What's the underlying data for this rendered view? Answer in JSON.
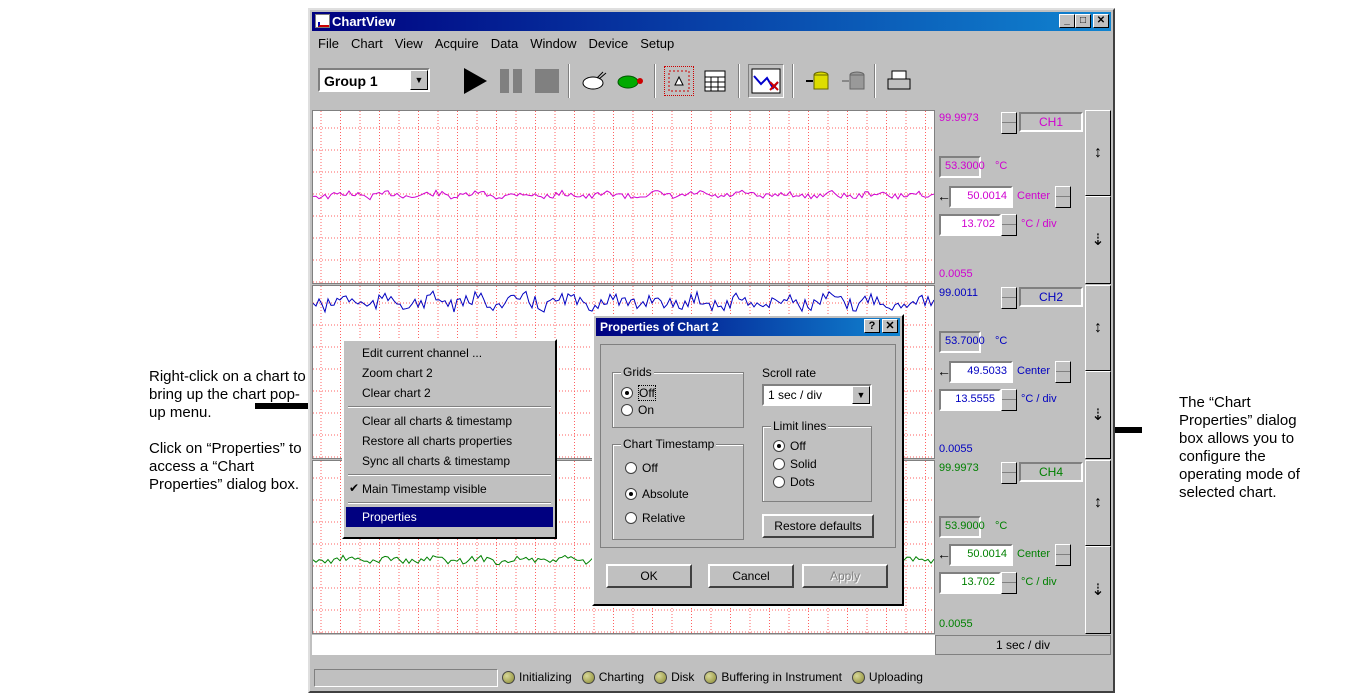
{
  "annotations": {
    "left": [
      "Right-click on a chart to",
      "bring up the chart pop-",
      "up menu."
    ],
    "left2": [
      "Click on “Properties” to",
      "access a “Chart",
      "Properties” dialog box."
    ],
    "right": [
      "The  “Chart",
      "Properties” dialog",
      "box allows you to",
      "configure the",
      "operating mode of",
      "selected chart."
    ]
  },
  "window": {
    "title": "ChartView",
    "controls": [
      "_",
      "□",
      "✕"
    ]
  },
  "menubar": [
    "File",
    "Chart",
    "View",
    "Acquire",
    "Data",
    "Window",
    "Device",
    "Setup"
  ],
  "toolbar": {
    "group_select": "Group 1",
    "icons": [
      "play-icon",
      "pause-icon",
      "stop-icon",
      "rabbit-icon",
      "turtle-icon",
      "zoom-hand-icon",
      "calculator-icon",
      "chart-icon",
      "upload-db-icon",
      "download-db-icon",
      "printer-icon"
    ]
  },
  "channels": [
    {
      "name": "CH1",
      "max": "99.9973",
      "current": "53.3000",
      "unit": "°C",
      "center": "50.0014",
      "center_label": "Center",
      "div": "13.702",
      "div_label": "°C / div",
      "min": "0.0055",
      "color": "#d000d0"
    },
    {
      "name": "CH2",
      "max": "99.0011",
      "current": "53.7000",
      "unit": "°C",
      "center": "49.5033",
      "center_label": "Center",
      "div": "13.5555",
      "div_label": "°C / div",
      "min": "0.0055",
      "color": "#0000c0"
    },
    {
      "name": "CH4",
      "max": "99.9973",
      "current": "53.9000",
      "unit": "°C",
      "center": "50.0014",
      "center_label": "Center",
      "div": "13.702",
      "div_label": "°C / div",
      "min": "0.0055",
      "color": "#008000"
    }
  ],
  "time_scale": "1 sec / div",
  "popup_menu": [
    {
      "label": "Edit current channel ...",
      "type": "item"
    },
    {
      "label": "Zoom chart 2",
      "type": "item"
    },
    {
      "label": "Clear chart 2",
      "type": "item"
    },
    {
      "type": "sep"
    },
    {
      "label": "Clear all charts & timestamp",
      "type": "item"
    },
    {
      "label": "Restore all charts properties",
      "type": "item"
    },
    {
      "label": "Sync all charts & timestamp",
      "type": "item"
    },
    {
      "type": "sep"
    },
    {
      "label": "Main Timestamp visible",
      "type": "item",
      "checked": true
    },
    {
      "type": "sep"
    },
    {
      "label": "Properties",
      "type": "item",
      "selected": true
    }
  ],
  "dialog": {
    "title": "Properties of Chart 2",
    "title_buttons": [
      "?",
      "✕"
    ],
    "grids": {
      "label": "Grids",
      "options": [
        "Off",
        "On"
      ],
      "selected": "Off"
    },
    "scroll_rate": {
      "label": "Scroll rate",
      "value": "1 sec / div"
    },
    "limit_lines": {
      "label": "Limit lines",
      "options": [
        "Off",
        "Solid",
        "Dots"
      ],
      "selected": "Off"
    },
    "chart_timestamp": {
      "label": "Chart Timestamp",
      "options": [
        "Off",
        "Absolute",
        "Relative"
      ],
      "selected": "Absolute"
    },
    "restore_defaults": "Restore defaults",
    "ok": "OK",
    "cancel": "Cancel",
    "apply": "Apply"
  },
  "status_indicators": [
    "Initializing",
    "Charting",
    "Disk",
    "Buffering in Instrument",
    "Uploading"
  ]
}
